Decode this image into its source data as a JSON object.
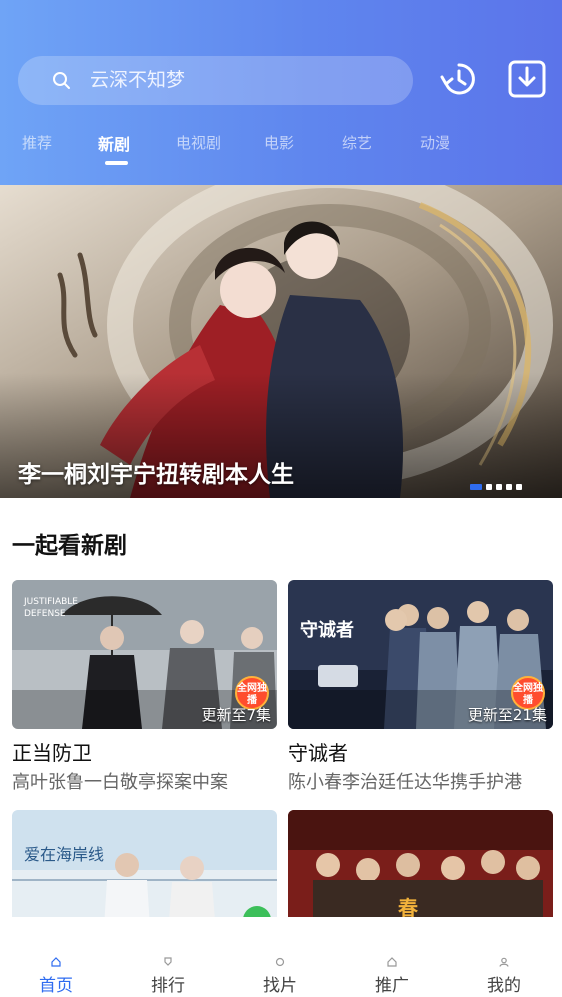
{
  "search": {
    "placeholder": "云深不知梦"
  },
  "header": {
    "history_icon": "history-icon",
    "download_icon": "download-icon"
  },
  "tabs": [
    {
      "label": "推荐",
      "active": false
    },
    {
      "label": "新剧",
      "active": true
    },
    {
      "label": "电视剧",
      "active": false
    },
    {
      "label": "电影",
      "active": false
    },
    {
      "label": "综艺",
      "active": false
    },
    {
      "label": "动漫",
      "active": false
    }
  ],
  "banner": {
    "title": "李一桐刘宇宁扭转剧本人生",
    "slide_count": 5,
    "active_slide": 1
  },
  "section": {
    "title": "一起看新剧"
  },
  "cards": [
    {
      "name": "正当防卫",
      "desc": "高叶张鲁一白敬亭探案中案",
      "episodes": "更新至7集",
      "badge": "全网独播"
    },
    {
      "name": "守诚者",
      "desc": "陈小春李治廷任达华携手护港",
      "episodes": "更新至21集",
      "badge": "全网独播"
    },
    {
      "name": "",
      "desc": "",
      "episodes": "",
      "badge": ""
    },
    {
      "name": "",
      "desc": "",
      "episodes": "",
      "badge": ""
    }
  ],
  "bottom_nav": [
    {
      "label": "首页",
      "active": true
    },
    {
      "label": "排行",
      "active": false
    },
    {
      "label": "找片",
      "active": false
    },
    {
      "label": "推广",
      "active": false
    },
    {
      "label": "我的",
      "active": false
    }
  ],
  "colors": {
    "accent": "#2f6cf0",
    "header_start": "#6fa4f6",
    "header_end": "#5b74ea"
  }
}
